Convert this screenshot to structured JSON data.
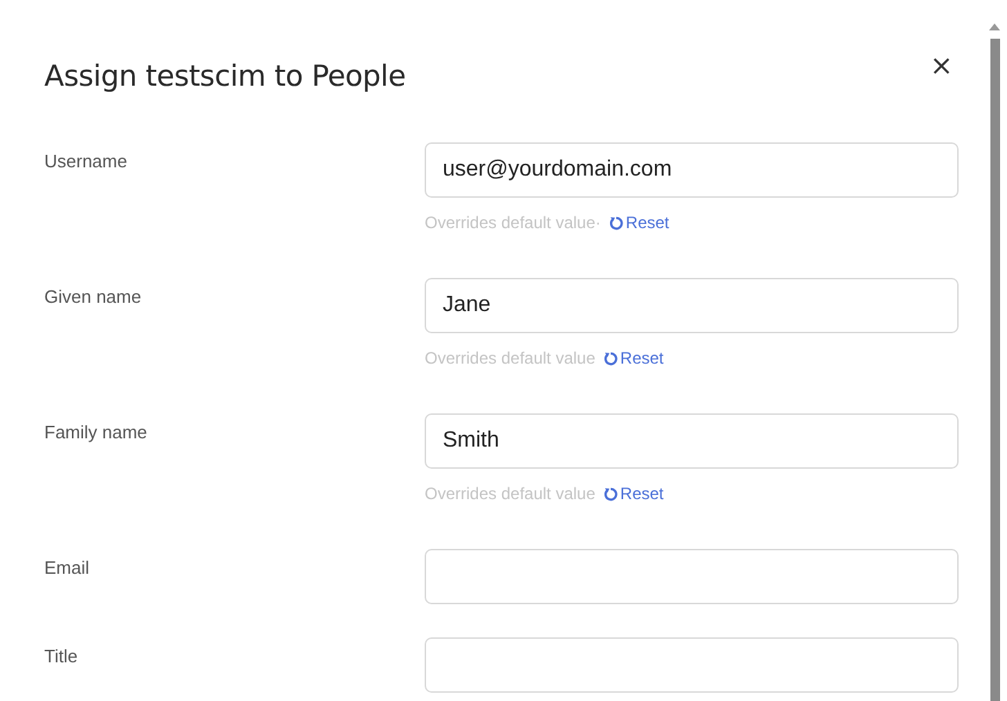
{
  "dialog": {
    "title": "Assign testscim to People",
    "close": "×"
  },
  "fields": [
    {
      "label": "Username",
      "value": "user@yourdomain.com",
      "overridden": true,
      "hint": "Overrides default value·",
      "reset": "Reset"
    },
    {
      "label": "Given name",
      "value": "Jane",
      "overridden": true,
      "hint": "Overrides default value",
      "reset": "Reset"
    },
    {
      "label": "Family name",
      "value": "Smith",
      "overridden": true,
      "hint": "Overrides default value",
      "reset": "Reset"
    },
    {
      "label": "Email",
      "overridden": false
    },
    {
      "label": "Title",
      "overridden": false
    }
  ]
}
